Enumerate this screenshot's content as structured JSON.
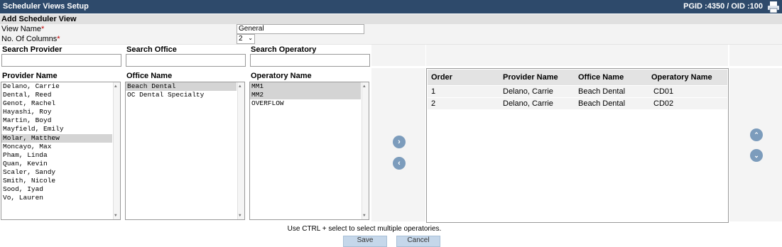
{
  "header": {
    "title": "Scheduler Views Setup",
    "ids": "PGID :4350  /  OID :100",
    "print_icon": "printer-icon"
  },
  "section": {
    "title": "Add Scheduler View"
  },
  "form": {
    "view_name_label": "View Name",
    "view_name_value": "General",
    "columns_label": "No. Of Columns",
    "columns_value": "2",
    "required_mark": "*"
  },
  "search": {
    "provider": "Search Provider",
    "office": "Search Office",
    "operatory": "Search Operatory"
  },
  "lists": {
    "provider_header": "Provider Name",
    "office_header": "Office Name",
    "operatory_header": "Operatory Name",
    "providers": [
      "Delano, Carrie",
      "Dental, Reed",
      "Genot, Rachel",
      "Hayashi, Roy",
      "Martin, Boyd",
      "Mayfield, Emily",
      "Molar, Matthew",
      "Moncayo, Max",
      "Pham, Linda",
      "Quan, Kevin",
      "Scaler, Sandy",
      "Smith, Nicole",
      "Sood, Iyad",
      "Vo, Lauren"
    ],
    "offices": [
      "Beach Dental",
      "OC Dental Specialty"
    ],
    "operatories": [
      "MM1",
      "MM2",
      "OVERFLOW"
    ]
  },
  "grid": {
    "headers": {
      "order": "Order",
      "provider": "Provider Name",
      "office": "Office Name",
      "operatory": "Operatory Name"
    },
    "rows": [
      {
        "order": "1",
        "provider": "Delano, Carrie",
        "office": "Beach Dental",
        "operatory": "CD01"
      },
      {
        "order": "2",
        "provider": "Delano, Carrie",
        "office": "Beach Dental",
        "operatory": "CD02"
      }
    ]
  },
  "note": "Use CTRL + select to select multiple operatories.",
  "buttons": {
    "save": "Save",
    "cancel": "Cancel"
  },
  "colors": {
    "header_bar": "#2e4a6b",
    "selected_row": "#d4d4d4",
    "action_button": "#7c9cbc"
  }
}
